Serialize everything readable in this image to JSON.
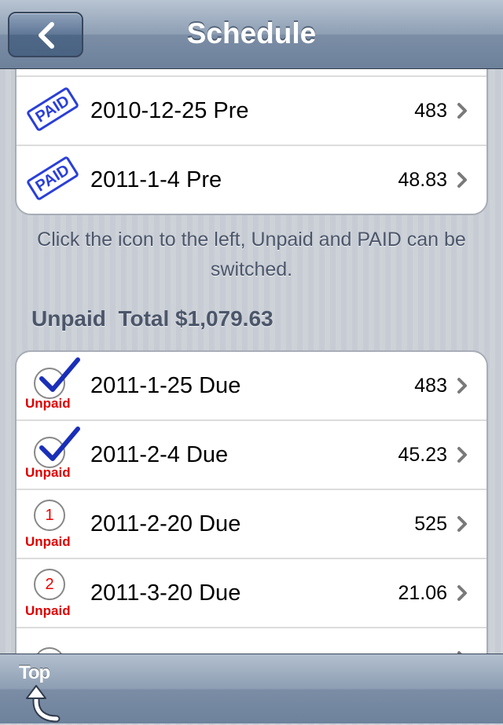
{
  "navbar": {
    "title": "Schedule",
    "back_icon": "chevron-left-icon"
  },
  "paid_group": {
    "rows": [
      {
        "status": "PAID",
        "label": "2010-12-25 Pre",
        "amount": "483"
      },
      {
        "status": "PAID",
        "label": "2011-1-4 Pre",
        "amount": "48.83"
      }
    ]
  },
  "hint": "Click the icon to the left, Unpaid and PAID can be switched.",
  "unpaid_section": {
    "header": "Unpaid  Total $1,079.63",
    "rows": [
      {
        "status": "Unpaid",
        "icon": "check",
        "label": "2011-1-25 Due",
        "amount": "483"
      },
      {
        "status": "Unpaid",
        "icon": "check",
        "label": "2011-2-4 Due",
        "amount": "45.23"
      },
      {
        "status": "Unpaid",
        "icon": "number",
        "number": "1",
        "label": "2011-2-20 Due",
        "amount": "525"
      },
      {
        "status": "Unpaid",
        "icon": "number",
        "number": "2",
        "label": "2011-3-20 Due",
        "amount": "21.06"
      }
    ]
  },
  "toolbar": {
    "top_label": "Top",
    "top_icon": "curved-up-arrow-icon"
  },
  "colors": {
    "paid_stamp": "#2a3fd8",
    "unpaid_text": "#dd0000",
    "check": "#1a2fb8"
  }
}
